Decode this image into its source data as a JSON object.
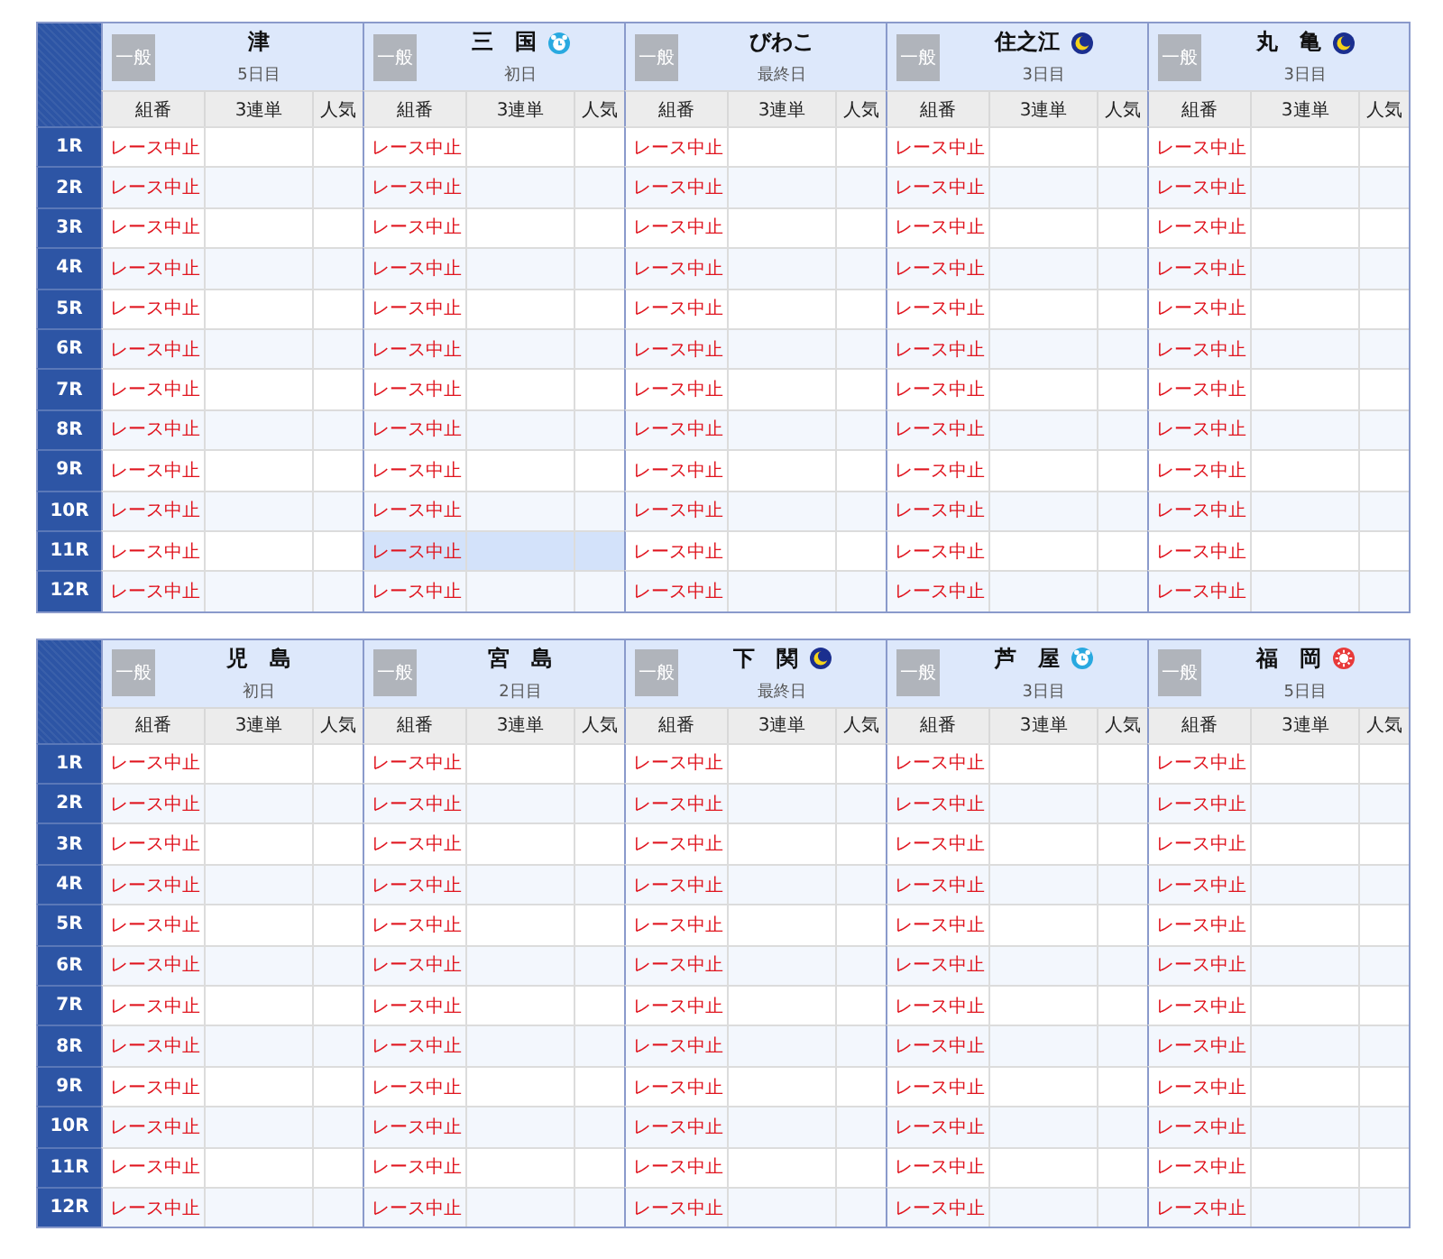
{
  "tables": [
    {
      "races": [
        "1R",
        "2R",
        "3R",
        "4R",
        "5R",
        "6R",
        "7R",
        "8R",
        "9R",
        "10R",
        "11R",
        "12R"
      ],
      "venues": [
        {
          "grade": "一般",
          "name": "津",
          "day": "5日目",
          "columns": [
            "組番",
            "3連単",
            "人気"
          ],
          "results": [
            {
              "text": "レース中止",
              "selected": false
            },
            {
              "text": "レース中止",
              "selected": false
            },
            {
              "text": "レース中止",
              "selected": false
            },
            {
              "text": "レース中止",
              "selected": false
            },
            {
              "text": "レース中止",
              "selected": false
            },
            {
              "text": "レース中止",
              "selected": false
            },
            {
              "text": "レース中止",
              "selected": false
            },
            {
              "text": "レース中止",
              "selected": false
            },
            {
              "text": "レース中止",
              "selected": false
            },
            {
              "text": "レース中止",
              "selected": false
            },
            {
              "text": "レース中止",
              "selected": false
            },
            {
              "text": "レース中止",
              "selected": false
            }
          ]
        },
        {
          "grade": "一般",
          "name": "三　国",
          "kind": "morning",
          "day": "初日",
          "columns": [
            "組番",
            "3連単",
            "人気"
          ],
          "results": [
            {
              "text": "レース中止",
              "selected": false
            },
            {
              "text": "レース中止",
              "selected": false
            },
            {
              "text": "レース中止",
              "selected": false
            },
            {
              "text": "レース中止",
              "selected": false
            },
            {
              "text": "レース中止",
              "selected": false
            },
            {
              "text": "レース中止",
              "selected": false
            },
            {
              "text": "レース中止",
              "selected": false
            },
            {
              "text": "レース中止",
              "selected": false
            },
            {
              "text": "レース中止",
              "selected": false
            },
            {
              "text": "レース中止",
              "selected": false
            },
            {
              "text": "レース中止",
              "selected": true
            },
            {
              "text": "レース中止",
              "selected": false
            }
          ]
        },
        {
          "grade": "一般",
          "name": "びわこ",
          "day": "最終日",
          "columns": [
            "組番",
            "3連単",
            "人気"
          ],
          "results": [
            {
              "text": "レース中止",
              "selected": false
            },
            {
              "text": "レース中止",
              "selected": false
            },
            {
              "text": "レース中止",
              "selected": false
            },
            {
              "text": "レース中止",
              "selected": false
            },
            {
              "text": "レース中止",
              "selected": false
            },
            {
              "text": "レース中止",
              "selected": false
            },
            {
              "text": "レース中止",
              "selected": false
            },
            {
              "text": "レース中止",
              "selected": false
            },
            {
              "text": "レース中止",
              "selected": false
            },
            {
              "text": "レース中止",
              "selected": false
            },
            {
              "text": "レース中止",
              "selected": false
            },
            {
              "text": "レース中止",
              "selected": false
            }
          ]
        },
        {
          "grade": "一般",
          "name": "住之江",
          "kind": "night",
          "day": "3日目",
          "columns": [
            "組番",
            "3連単",
            "人気"
          ],
          "results": [
            {
              "text": "レース中止",
              "selected": false
            },
            {
              "text": "レース中止",
              "selected": false
            },
            {
              "text": "レース中止",
              "selected": false
            },
            {
              "text": "レース中止",
              "selected": false
            },
            {
              "text": "レース中止",
              "selected": false
            },
            {
              "text": "レース中止",
              "selected": false
            },
            {
              "text": "レース中止",
              "selected": false
            },
            {
              "text": "レース中止",
              "selected": false
            },
            {
              "text": "レース中止",
              "selected": false
            },
            {
              "text": "レース中止",
              "selected": false
            },
            {
              "text": "レース中止",
              "selected": false
            },
            {
              "text": "レース中止",
              "selected": false
            }
          ]
        },
        {
          "grade": "一般",
          "name": "丸　亀",
          "kind": "night",
          "day": "3日目",
          "columns": [
            "組番",
            "3連単",
            "人気"
          ],
          "results": [
            {
              "text": "レース中止",
              "selected": false
            },
            {
              "text": "レース中止",
              "selected": false
            },
            {
              "text": "レース中止",
              "selected": false
            },
            {
              "text": "レース中止",
              "selected": false
            },
            {
              "text": "レース中止",
              "selected": false
            },
            {
              "text": "レース中止",
              "selected": false
            },
            {
              "text": "レース中止",
              "selected": false
            },
            {
              "text": "レース中止",
              "selected": false
            },
            {
              "text": "レース中止",
              "selected": false
            },
            {
              "text": "レース中止",
              "selected": false
            },
            {
              "text": "レース中止",
              "selected": false
            },
            {
              "text": "レース中止",
              "selected": false
            }
          ]
        }
      ]
    },
    {
      "races": [
        "1R",
        "2R",
        "3R",
        "4R",
        "5R",
        "6R",
        "7R",
        "8R",
        "9R",
        "10R",
        "11R",
        "12R"
      ],
      "venues": [
        {
          "grade": "一般",
          "name": "児　島",
          "day": "初日",
          "columns": [
            "組番",
            "3連単",
            "人気"
          ],
          "results": [
            {
              "text": "レース中止",
              "selected": false
            },
            {
              "text": "レース中止",
              "selected": false
            },
            {
              "text": "レース中止",
              "selected": false
            },
            {
              "text": "レース中止",
              "selected": false
            },
            {
              "text": "レース中止",
              "selected": false
            },
            {
              "text": "レース中止",
              "selected": false
            },
            {
              "text": "レース中止",
              "selected": false
            },
            {
              "text": "レース中止",
              "selected": false
            },
            {
              "text": "レース中止",
              "selected": false
            },
            {
              "text": "レース中止",
              "selected": false
            },
            {
              "text": "レース中止",
              "selected": false
            },
            {
              "text": "レース中止",
              "selected": false
            }
          ]
        },
        {
          "grade": "一般",
          "name": "宮　島",
          "day": "2日目",
          "columns": [
            "組番",
            "3連単",
            "人気"
          ],
          "results": [
            {
              "text": "レース中止",
              "selected": false
            },
            {
              "text": "レース中止",
              "selected": false
            },
            {
              "text": "レース中止",
              "selected": false
            },
            {
              "text": "レース中止",
              "selected": false
            },
            {
              "text": "レース中止",
              "selected": false
            },
            {
              "text": "レース中止",
              "selected": false
            },
            {
              "text": "レース中止",
              "selected": false
            },
            {
              "text": "レース中止",
              "selected": false
            },
            {
              "text": "レース中止",
              "selected": false
            },
            {
              "text": "レース中止",
              "selected": false
            },
            {
              "text": "レース中止",
              "selected": false
            },
            {
              "text": "レース中止",
              "selected": false
            }
          ]
        },
        {
          "grade": "一般",
          "name": "下　関",
          "kind": "night",
          "day": "最終日",
          "columns": [
            "組番",
            "3連単",
            "人気"
          ],
          "results": [
            {
              "text": "レース中止",
              "selected": false
            },
            {
              "text": "レース中止",
              "selected": false
            },
            {
              "text": "レース中止",
              "selected": false
            },
            {
              "text": "レース中止",
              "selected": false
            },
            {
              "text": "レース中止",
              "selected": false
            },
            {
              "text": "レース中止",
              "selected": false
            },
            {
              "text": "レース中止",
              "selected": false
            },
            {
              "text": "レース中止",
              "selected": false
            },
            {
              "text": "レース中止",
              "selected": false
            },
            {
              "text": "レース中止",
              "selected": false
            },
            {
              "text": "レース中止",
              "selected": false
            },
            {
              "text": "レース中止",
              "selected": false
            }
          ]
        },
        {
          "grade": "一般",
          "name": "芦　屋",
          "kind": "morning",
          "day": "3日目",
          "columns": [
            "組番",
            "3連単",
            "人気"
          ],
          "results": [
            {
              "text": "レース中止",
              "selected": false
            },
            {
              "text": "レース中止",
              "selected": false
            },
            {
              "text": "レース中止",
              "selected": false
            },
            {
              "text": "レース中止",
              "selected": false
            },
            {
              "text": "レース中止",
              "selected": false
            },
            {
              "text": "レース中止",
              "selected": false
            },
            {
              "text": "レース中止",
              "selected": false
            },
            {
              "text": "レース中止",
              "selected": false
            },
            {
              "text": "レース中止",
              "selected": false
            },
            {
              "text": "レース中止",
              "selected": false
            },
            {
              "text": "レース中止",
              "selected": false
            },
            {
              "text": "レース中止",
              "selected": false
            }
          ]
        },
        {
          "grade": "一般",
          "name": "福　岡",
          "kind": "summer",
          "day": "5日目",
          "columns": [
            "組番",
            "3連単",
            "人気"
          ],
          "results": [
            {
              "text": "レース中止",
              "selected": false
            },
            {
              "text": "レース中止",
              "selected": false
            },
            {
              "text": "レース中止",
              "selected": false
            },
            {
              "text": "レース中止",
              "selected": false
            },
            {
              "text": "レース中止",
              "selected": false
            },
            {
              "text": "レース中止",
              "selected": false
            },
            {
              "text": "レース中止",
              "selected": false
            },
            {
              "text": "レース中止",
              "selected": false
            },
            {
              "text": "レース中止",
              "selected": false
            },
            {
              "text": "レース中止",
              "selected": false
            },
            {
              "text": "レース中止",
              "selected": false
            },
            {
              "text": "レース中止",
              "selected": false
            }
          ]
        }
      ]
    }
  ]
}
